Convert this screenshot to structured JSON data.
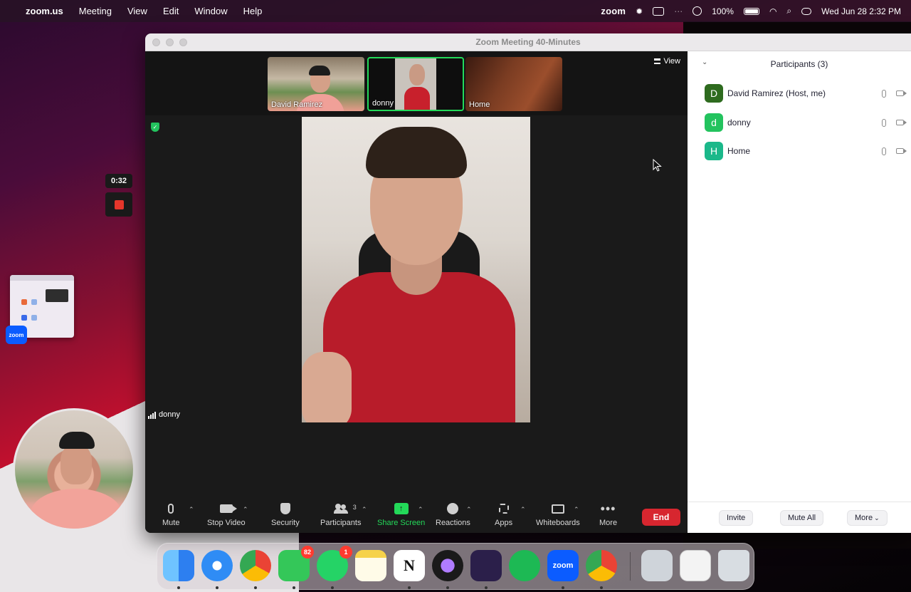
{
  "menubar": {
    "app_name": "zoom.us",
    "menus": [
      "Meeting",
      "View",
      "Edit",
      "Window",
      "Help"
    ],
    "zoom_logo": "zoom",
    "battery": "100%",
    "datetime": "Wed Jun 28  2:32 PM"
  },
  "recording": {
    "elapsed": "0:32"
  },
  "desktop_thumb": {
    "badge": "zoom"
  },
  "window": {
    "title": "Zoom Meeting  40-Minutes"
  },
  "gallery": {
    "view_label": "View",
    "tiles": [
      {
        "name": "David Ramirez",
        "selected": false
      },
      {
        "name": "donny",
        "selected": true
      },
      {
        "name": "Home",
        "selected": false
      }
    ]
  },
  "active_speaker": {
    "name": "donny"
  },
  "toolbar": {
    "mute": "Mute",
    "stop_video": "Stop Video",
    "security": "Security",
    "participants": "Participants",
    "participants_count": "3",
    "share_screen": "Share Screen",
    "reactions": "Reactions",
    "apps": "Apps",
    "whiteboards": "Whiteboards",
    "more": "More",
    "end": "End"
  },
  "participants_panel": {
    "title": "Participants (3)",
    "participants": [
      {
        "initial": "D",
        "name": "David Ramirez (Host, me)",
        "color": "#2e6b1f"
      },
      {
        "initial": "d",
        "name": "donny",
        "color": "#23c35e"
      },
      {
        "initial": "H",
        "name": "Home",
        "color": "#1bb88a"
      }
    ],
    "invite": "Invite",
    "mute_all": "Mute All",
    "more": "More"
  },
  "dock": {
    "apps": [
      {
        "name": "Finder",
        "color": "#3a8ef0",
        "label": ""
      },
      {
        "name": "Safari",
        "color": "#1e7ef0",
        "label": ""
      },
      {
        "name": "Chrome",
        "color": "#ffffff",
        "label": ""
      },
      {
        "name": "Messages",
        "color": "#34c759",
        "label": "",
        "badge": "82"
      },
      {
        "name": "WhatsApp",
        "color": "#25d366",
        "label": "",
        "badge": "1"
      },
      {
        "name": "Notes",
        "color": "#f6d24a",
        "label": ""
      },
      {
        "name": "Notion",
        "color": "#ffffff",
        "label": "N"
      },
      {
        "name": "Arc",
        "color": "#1a1a1a",
        "label": ""
      },
      {
        "name": "Linear",
        "color": "#2b1f4a",
        "label": ""
      },
      {
        "name": "Spotify",
        "color": "#1db954",
        "label": ""
      },
      {
        "name": "Zoom",
        "color": "#0b5cff",
        "label": "zoom"
      },
      {
        "name": "Chrome2",
        "color": "#ffffff",
        "label": ""
      },
      {
        "name": "Preview",
        "color": "#cfd4da",
        "label": ""
      },
      {
        "name": "Document",
        "color": "#f3f3f3",
        "label": ""
      },
      {
        "name": "Trash",
        "color": "#d8dde2",
        "label": ""
      }
    ]
  }
}
